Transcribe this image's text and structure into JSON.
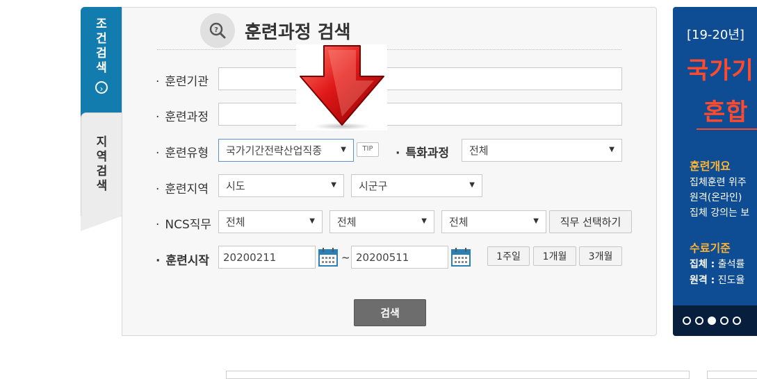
{
  "tabs": {
    "condition_search": "조건검색",
    "region_search": "지역검색"
  },
  "panel": {
    "title": "훈련과정 검색"
  },
  "form": {
    "institution_label": "훈련기관",
    "institution_value": "",
    "course_label": "훈련과정",
    "course_value": "",
    "type_label": "훈련유형",
    "type_selected": "국가기간전략산업직종",
    "tip_label": "TIP",
    "special_label": "특화과정",
    "special_selected": "전체",
    "region_label": "훈련지역",
    "region_sido": "시도",
    "region_sigungu": "시군구",
    "ncs_label": "NCS직무",
    "ncs_1": "전체",
    "ncs_2": "전체",
    "ncs_3": "전체",
    "ncs_button": "직무 선택하기",
    "start_label": "훈련시작",
    "start_from": "20200211",
    "tilde": "~",
    "start_to": "20200511",
    "period_1w": "1주일",
    "period_1m": "1개월",
    "period_3m": "3개월",
    "search_button": "검색"
  },
  "banner": {
    "tag": "[19-20년]",
    "title_line1": "국가기",
    "title_line2": "혼합",
    "overview_heading": "훈련개요",
    "overview_line1": "집체훈련 위주",
    "overview_line2": "원격(온라인)",
    "overview_line3": "집체 강의는 보",
    "completion_heading": "수료기준",
    "completion_line1_bold": "집체 :",
    "completion_line1": " 출석률",
    "completion_line2_bold": "원격 :",
    "completion_line2": " 진도율",
    "slides_total": 5,
    "slide_active": 3
  },
  "colors": {
    "tab_active": "#137cae",
    "banner_bg": "#0e4d94",
    "banner_title": "#ff4a2e",
    "banner_heading": "#ffb431",
    "arrow_red": "#d41414"
  }
}
